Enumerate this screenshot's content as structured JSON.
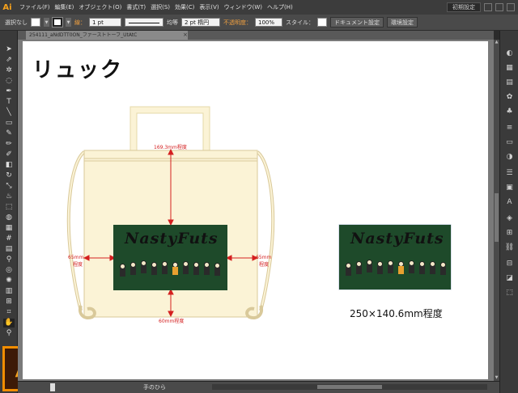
{
  "app": {
    "logo": "Ai"
  },
  "menu": [
    "ファイル(F)",
    "編集(E)",
    "オブジェクト(O)",
    "書式(T)",
    "選択(S)",
    "効果(C)",
    "表示(V)",
    "ウィンドウ(W)",
    "ヘルプ(H)"
  ],
  "workspace": "初期設定",
  "control": {
    "selection": "選択なし",
    "stroke_label": "線：",
    "stroke_weight": "1 pt",
    "profile": "均等",
    "brush": "2 pt 楕円",
    "opacity_label": "不透明度：",
    "opacity": "100%",
    "style_label": "スタイル：",
    "doc_setup": "ドキュメント設定",
    "prefs": "環境設定"
  },
  "tab": {
    "title": "254111_aNdDTT0ON_ファーストトーフ_UtAtC"
  },
  "canvas": {
    "title": "リュック",
    "dims": {
      "top": "169.3mm程度",
      "left_1": "65mm",
      "left_2": "程度",
      "right_1": "65mm",
      "right_2": "程度",
      "bottom": "60mm程度"
    },
    "band_name": "NastyFuts",
    "caption": "250×140.6mm程度"
  },
  "status": {
    "zoom": "",
    "tool": "手のひら"
  },
  "colors": {
    "accent": "#f7a21b",
    "print_bg": "#1e4a2a",
    "bag": "#fbf3d6",
    "dimension": "#d42020"
  }
}
